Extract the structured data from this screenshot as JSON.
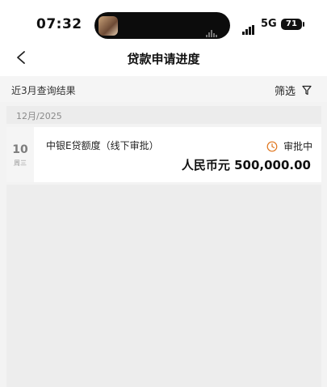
{
  "status_bar": {
    "time": "07:32",
    "network": "5G",
    "battery": "71"
  },
  "nav": {
    "title": "贷款申请进度",
    "back_icon": "chevron-left-icon"
  },
  "filter": {
    "range_label": "近3月查询结果",
    "filter_label": "筛选",
    "filter_icon": "funnel-icon"
  },
  "records": [
    {
      "month": "12月/2025",
      "day": "10",
      "weekday": "周三",
      "product": "中银E贷额度（线下审批）",
      "status": "审批中",
      "status_icon": "clock-icon",
      "amount": "人民币元 500,000.00"
    }
  ],
  "colors": {
    "status_accent": "#e0761e",
    "page_background": "#f3f3f3",
    "card_background": "#ffffff"
  }
}
